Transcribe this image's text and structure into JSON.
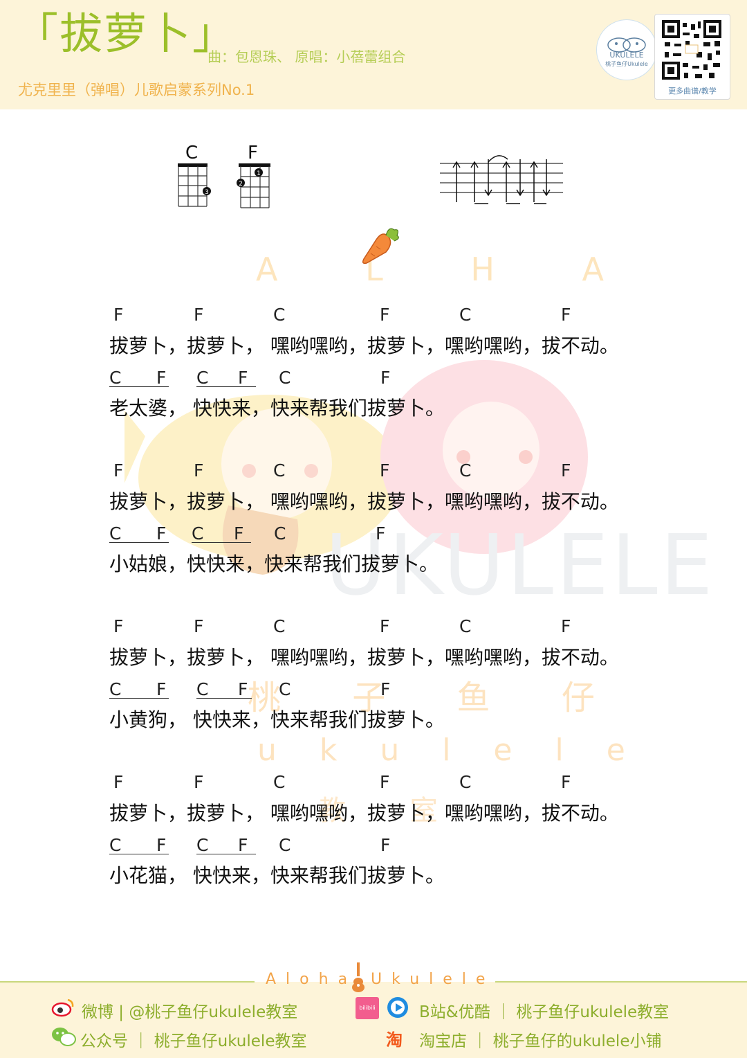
{
  "header": {
    "title": "「拔萝卜」",
    "credits": "曲：包恩珠、 原唱：小蓓蕾组合",
    "series": "尤克里里（弹唱）儿歌启蒙系列No.1",
    "logo_text": "桃子鱼仔Ukulele",
    "qr_caption": "更多曲谱/教学"
  },
  "chord_diagrams": [
    {
      "name": "C",
      "fingers": [
        {
          "string": 4,
          "fret": 3,
          "finger": "3"
        }
      ]
    },
    {
      "name": "F",
      "fingers": [
        {
          "string": 1,
          "fret": 2,
          "finger": "2"
        },
        {
          "string": 3,
          "fret": 1,
          "finger": "1"
        }
      ]
    }
  ],
  "strum_pattern": {
    "strokes": [
      "down",
      "down",
      "up",
      "down",
      "up",
      "down",
      "up"
    ]
  },
  "watermarks": {
    "aloha": "A L H A",
    "ukulele_big": "UKULELE",
    "brand_cn": "桃 子 鱼 仔",
    "brand_en": "u k u l e l e",
    "edu": "教 室"
  },
  "verses": [
    {
      "chords1": [
        "F",
        "F",
        "C",
        "F",
        "C",
        "F"
      ],
      "lyric1": "拔萝卜，拔萝卜， 嘿哟嘿哟，拔萝卜，嘿哟嘿哟，拔不动。",
      "chords2": [
        "C",
        "F",
        "C",
        "F",
        "C",
        "F"
      ],
      "lyric2": "老太婆， 快快来，快来帮我们拔萝卜。"
    },
    {
      "chords1": [
        "F",
        "F",
        "C",
        "F",
        "C",
        "F"
      ],
      "lyric1": "拔萝卜，拔萝卜， 嘿哟嘿哟，拔萝卜，嘿哟嘿哟，拔不动。",
      "chords2": [
        "C",
        "F",
        "C",
        "F",
        "C",
        "F"
      ],
      "lyric2": "小姑娘，快快来，快来帮我们拔萝卜。"
    },
    {
      "chords1": [
        "F",
        "F",
        "C",
        "F",
        "C",
        "F"
      ],
      "lyric1": "拔萝卜，拔萝卜， 嘿哟嘿哟，拔萝卜，嘿哟嘿哟，拔不动。",
      "chords2": [
        "C",
        "F",
        "C",
        "F",
        "C",
        "F"
      ],
      "lyric2": "小黄狗， 快快来，快来帮我们拔萝卜。"
    },
    {
      "chords1": [
        "F",
        "F",
        "C",
        "F",
        "C",
        "F"
      ],
      "lyric1": "拔萝卜，拔萝卜， 嘿哟嘿哟，拔萝卜，嘿哟嘿哟，拔不动。",
      "chords2": [
        "C",
        "F",
        "C",
        "F",
        "C",
        "F"
      ],
      "lyric2": "小花猫， 快快来，快来帮我们拔萝卜。"
    }
  ],
  "footer": {
    "aloha": "Aloha",
    "ukulele": "Ukulele",
    "weibo": "微博 | @桃子鱼仔ukulele教室",
    "wechat": "公众号 ｜ 桃子鱼仔ukulele教室",
    "bilibili": "B站&优酷 ｜ 桃子鱼仔ukulele教室",
    "taobao": "淘宝店 ｜ 桃子鱼仔的ukulele小铺",
    "taobao_icon": "淘",
    "bilibili_icon": "bilibili",
    "colors": {
      "green": "#8dae2d",
      "orange": "#f2a44a",
      "cream": "#fdf4d9"
    }
  }
}
